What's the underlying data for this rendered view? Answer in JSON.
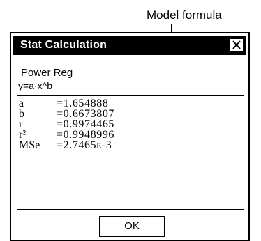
{
  "annotation": {
    "label": "Model formula"
  },
  "dialog": {
    "title": "Stat Calculation",
    "close_icon": "close-icon",
    "regression_type": "Power Reg",
    "formula": "y=a·x^b",
    "results": [
      {
        "label": "a",
        "value": "=1.654888"
      },
      {
        "label": "b",
        "value": "=0.6673807"
      },
      {
        "label": "r",
        "value": "=0.9974465"
      },
      {
        "label": "r²",
        "value": "=0.9948996"
      },
      {
        "label": "MSe",
        "value": "=2.7465ᴇ-3"
      }
    ],
    "ok_label": "OK"
  }
}
